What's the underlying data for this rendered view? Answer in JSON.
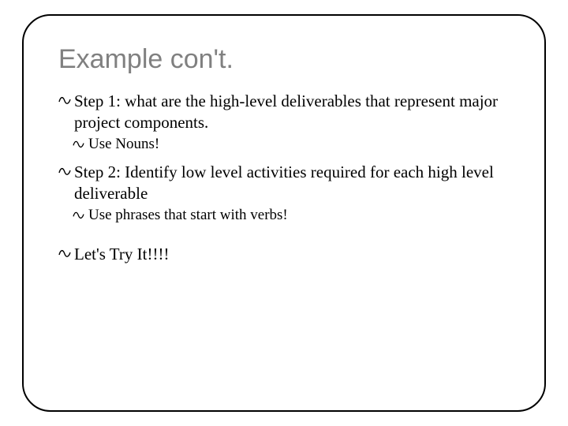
{
  "title": "Example con't.",
  "items": [
    {
      "level": 1,
      "text": "Step 1:  what are the high-level deliverables that represent major project components."
    },
    {
      "level": 2,
      "text": "Use Nouns!"
    },
    {
      "level": 1,
      "text": "Step 2:  Identify low level activities required for each high level deliverable"
    },
    {
      "level": 2,
      "text": "Use phrases that start with verbs!"
    },
    {
      "level": 1,
      "text": "Let's Try It!!!!"
    }
  ]
}
